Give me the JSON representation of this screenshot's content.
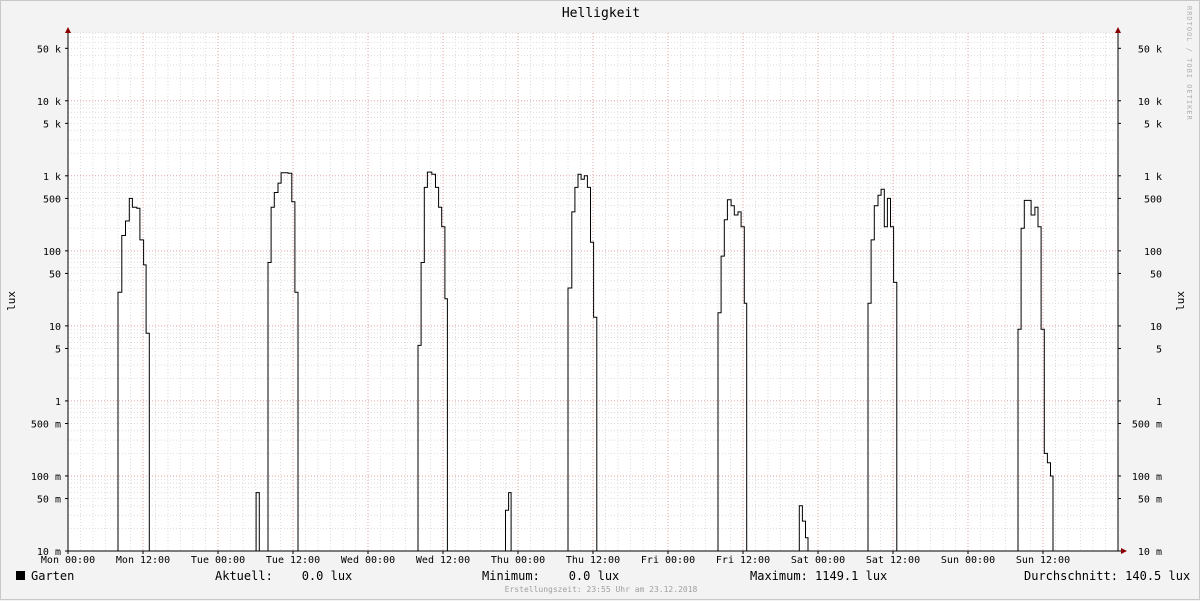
{
  "chart_data": {
    "type": "line",
    "title": "Helligkeit",
    "ylabel": "lux",
    "y_scale": "log",
    "ylim": [
      0.01,
      80000
    ],
    "grid": true,
    "y_ticks": [
      {
        "value": 0.01,
        "label": "10 m"
      },
      {
        "value": 0.05,
        "label": "50 m"
      },
      {
        "value": 0.1,
        "label": "100 m"
      },
      {
        "value": 0.5,
        "label": "500 m"
      },
      {
        "value": 1,
        "label": "1"
      },
      {
        "value": 5,
        "label": "5"
      },
      {
        "value": 10,
        "label": "10"
      },
      {
        "value": 50,
        "label": "50"
      },
      {
        "value": 100,
        "label": "100"
      },
      {
        "value": 500,
        "label": "500"
      },
      {
        "value": 1000,
        "label": "1 k"
      },
      {
        "value": 5000,
        "label": "5 k"
      },
      {
        "value": 10000,
        "label": "10 k"
      },
      {
        "value": 50000,
        "label": "50 k"
      }
    ],
    "x_unit": "hours since Mon 00:00",
    "xlim": [
      0,
      168
    ],
    "x_ticks": [
      {
        "value": 0,
        "label": "Mon 00:00"
      },
      {
        "value": 12,
        "label": "Mon 12:00"
      },
      {
        "value": 24,
        "label": "Tue 00:00"
      },
      {
        "value": 36,
        "label": "Tue 12:00"
      },
      {
        "value": 48,
        "label": "Wed 00:00"
      },
      {
        "value": 60,
        "label": "Wed 12:00"
      },
      {
        "value": 72,
        "label": "Thu 00:00"
      },
      {
        "value": 84,
        "label": "Thu 12:00"
      },
      {
        "value": 96,
        "label": "Fri 00:00"
      },
      {
        "value": 108,
        "label": "Fri 12:00"
      },
      {
        "value": 120,
        "label": "Sat 00:00"
      },
      {
        "value": 132,
        "label": "Sat 12:00"
      },
      {
        "value": 144,
        "label": "Sun 00:00"
      },
      {
        "value": 156,
        "label": "Sun 12:00"
      }
    ],
    "series": [
      {
        "name": "Garten",
        "color": "#000000",
        "step": true,
        "points": [
          [
            0,
            0.01
          ],
          [
            7.9,
            0.01
          ],
          [
            8.0,
            28
          ],
          [
            8.6,
            160
          ],
          [
            9.2,
            250
          ],
          [
            9.8,
            500
          ],
          [
            10.3,
            380
          ],
          [
            11.0,
            370
          ],
          [
            11.5,
            140
          ],
          [
            12.1,
            65
          ],
          [
            12.5,
            8
          ],
          [
            13.0,
            0.01
          ],
          [
            30.0,
            0.01
          ],
          [
            30.1,
            0.06
          ],
          [
            30.6,
            0.01
          ],
          [
            31.9,
            0.01
          ],
          [
            32.0,
            70
          ],
          [
            32.5,
            380
          ],
          [
            33.0,
            600
          ],
          [
            33.6,
            800
          ],
          [
            34.1,
            1100
          ],
          [
            35.2,
            1080
          ],
          [
            35.8,
            450
          ],
          [
            36.3,
            28
          ],
          [
            36.8,
            0.01
          ],
          [
            55.9,
            0.01
          ],
          [
            56.0,
            5.5
          ],
          [
            56.5,
            70
          ],
          [
            57.0,
            700
          ],
          [
            57.5,
            1120
          ],
          [
            58.2,
            1050
          ],
          [
            58.8,
            700
          ],
          [
            59.3,
            380
          ],
          [
            59.8,
            210
          ],
          [
            60.3,
            23
          ],
          [
            60.7,
            0.01
          ],
          [
            69.9,
            0.01
          ],
          [
            70.0,
            0.035
          ],
          [
            70.5,
            0.06
          ],
          [
            70.9,
            0.01
          ],
          [
            79.9,
            0.01
          ],
          [
            80.0,
            32
          ],
          [
            80.6,
            330
          ],
          [
            81.1,
            700
          ],
          [
            81.6,
            1050
          ],
          [
            82.1,
            900
          ],
          [
            82.6,
            1000
          ],
          [
            83.1,
            700
          ],
          [
            83.6,
            130
          ],
          [
            84.1,
            13
          ],
          [
            84.6,
            0.01
          ],
          [
            103.9,
            0.01
          ],
          [
            104.0,
            15
          ],
          [
            104.5,
            85
          ],
          [
            105.0,
            260
          ],
          [
            105.5,
            480
          ],
          [
            106.1,
            400
          ],
          [
            106.6,
            300
          ],
          [
            107.2,
            330
          ],
          [
            107.7,
            210
          ],
          [
            108.2,
            20
          ],
          [
            108.6,
            0.01
          ],
          [
            116.9,
            0.01
          ],
          [
            117.0,
            0.04
          ],
          [
            117.5,
            0.025
          ],
          [
            118.0,
            0.015
          ],
          [
            118.4,
            0.01
          ],
          [
            127.9,
            0.01
          ],
          [
            128.0,
            20
          ],
          [
            128.5,
            140
          ],
          [
            129.0,
            400
          ],
          [
            129.6,
            550
          ],
          [
            130.1,
            660
          ],
          [
            130.6,
            210
          ],
          [
            131.1,
            500
          ],
          [
            131.6,
            210
          ],
          [
            132.1,
            38
          ],
          [
            132.6,
            0.01
          ],
          [
            151.9,
            0.01
          ],
          [
            152.0,
            9
          ],
          [
            152.5,
            200
          ],
          [
            153.0,
            470
          ],
          [
            154.1,
            300
          ],
          [
            154.7,
            380
          ],
          [
            155.2,
            210
          ],
          [
            155.7,
            9
          ],
          [
            156.2,
            0.2
          ],
          [
            156.7,
            0.15
          ],
          [
            157.2,
            0.1
          ],
          [
            157.6,
            0.01
          ],
          [
            168,
            0.01
          ]
        ]
      }
    ]
  },
  "legend": {
    "series_label": "Garten",
    "current": "Aktuell:    0.0 lux",
    "minimum": "Minimum:    0.0 lux",
    "maximum": "Maximum: 1149.1 lux",
    "average": "Durchschnitt: 140.5 lux"
  },
  "watermark": "RRDTOOL / TOBI OETIKER",
  "footer": "Erstellungszeit: 23:55 Uhr am 23.12.2018",
  "colors": {
    "minor_grid": "#dddddd",
    "major_grid": "#e6a3a3",
    "axis": "#000000",
    "arrow": "#8b0000"
  }
}
